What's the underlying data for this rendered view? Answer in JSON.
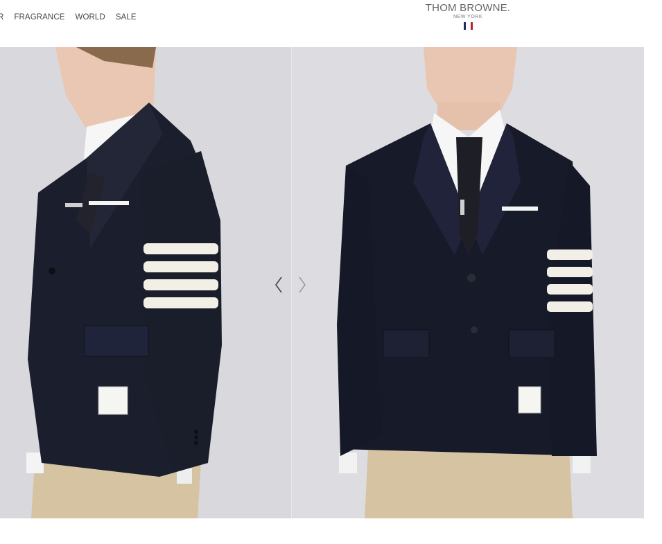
{
  "nav": {
    "items": [
      {
        "label": "R"
      },
      {
        "label": "FRAGRANCE"
      },
      {
        "label": "WORLD"
      },
      {
        "label": "SALE"
      }
    ]
  },
  "logo": {
    "brand": "THOM BROWNE.",
    "city": "NEW YORK",
    "flag_colors": [
      "#1d2a6b",
      "#ffffff",
      "#b3232f"
    ]
  },
  "gallery": {
    "prev_icon": "chevron-left-icon",
    "next_icon": "chevron-right-icon",
    "images": [
      {
        "name": "side view of navy blazer with four white stripes"
      },
      {
        "name": "front view of navy blazer with four white stripes"
      }
    ]
  },
  "colors": {
    "navy": "#1a1d2b",
    "stripe": "#f1efe6",
    "background": "#d9d9de"
  }
}
